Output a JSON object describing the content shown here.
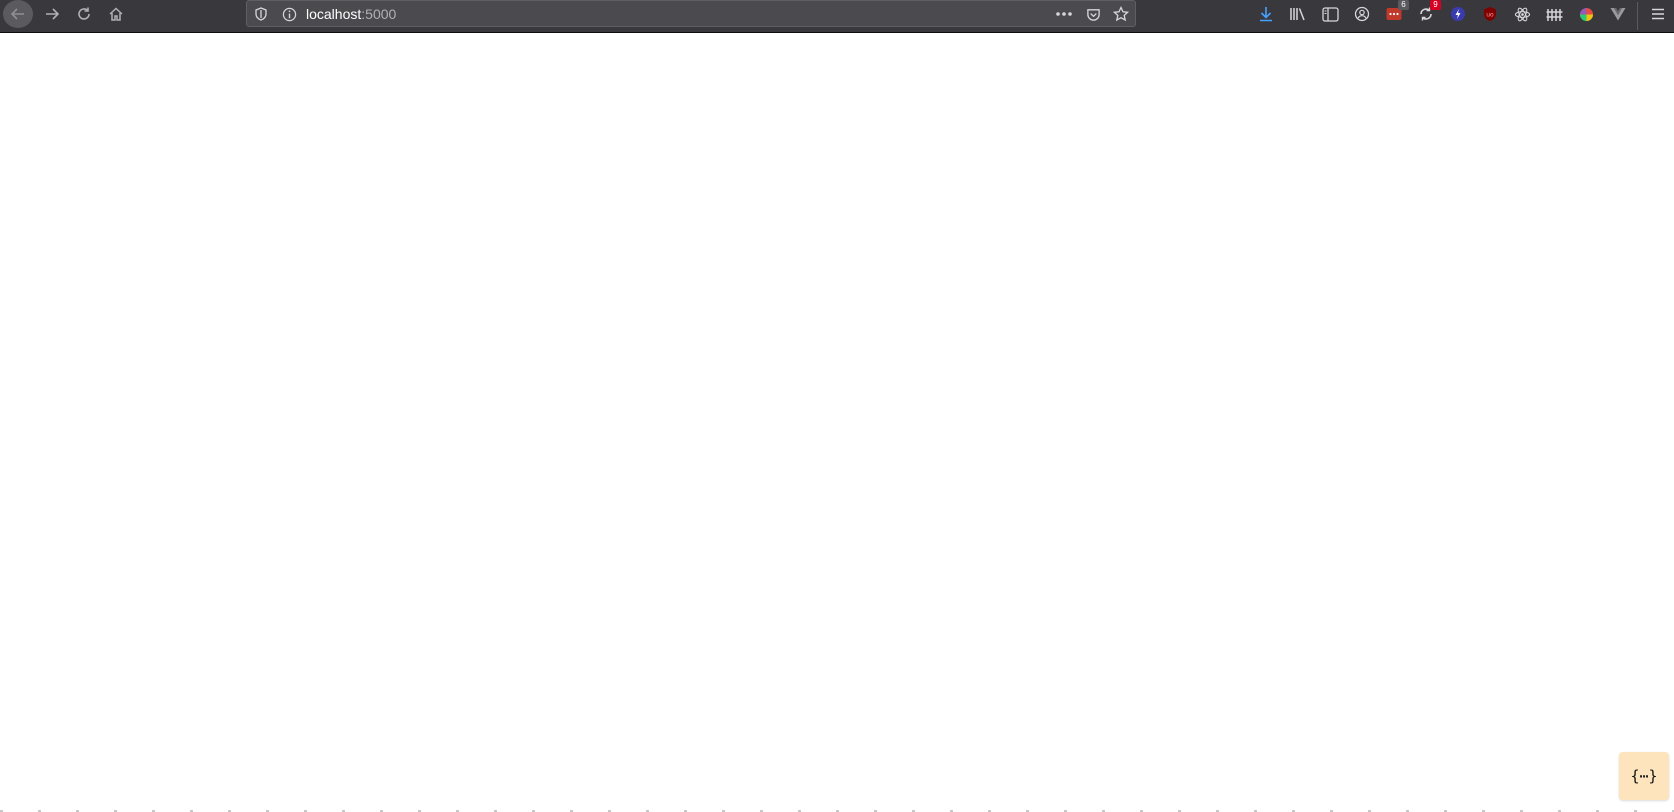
{
  "browser": {
    "url_host": "localhost",
    "url_port": ":5000",
    "extensions": {
      "badge_red_count": "6",
      "badge_sync_count": "9"
    },
    "colors": {
      "toolbar": "#38383d",
      "urlbar": "#4a4a4f",
      "download_icon": "#45a1ff"
    }
  },
  "page": {
    "json_viewer_button_label": "{⋯}",
    "json_viewer_button_color": "#fde4bd"
  }
}
